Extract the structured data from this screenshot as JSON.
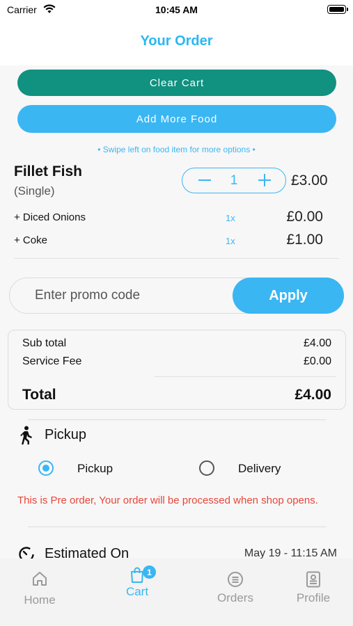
{
  "status_bar": {
    "carrier": "Carrier",
    "time": "10:45 AM"
  },
  "header": {
    "title": "Your Order"
  },
  "actions": {
    "clear_cart": "Clear Cart",
    "add_more_food": "Add More Food"
  },
  "hint": "• Swipe left on food item for more options •",
  "cart_item": {
    "name": "Fillet Fish",
    "variant": "(Single)",
    "quantity": "1",
    "price": "£3.00",
    "addons": [
      {
        "name": "+ Diced Onions",
        "qty": "1x",
        "price": "£0.00"
      },
      {
        "name": "+ Coke",
        "qty": "1x",
        "price": "£1.00"
      }
    ]
  },
  "promo": {
    "placeholder": "Enter promo code",
    "apply_label": "Apply"
  },
  "summary": {
    "subtotal_label": "Sub total",
    "subtotal_value": "£4.00",
    "fee_label": "Service Fee",
    "fee_value": "£0.00",
    "total_label": "Total",
    "total_value": "£4.00"
  },
  "fulfillment": {
    "title": "Pickup",
    "options": [
      {
        "label": "Pickup",
        "selected": true
      },
      {
        "label": "Delivery",
        "selected": false
      }
    ],
    "notice": "This is Pre order, Your order will be processed when shop opens."
  },
  "estimate": {
    "label": "Estimated On",
    "value": "May 19 - 11:15 AM"
  },
  "tabbar": {
    "home": "Home",
    "cart": "Cart",
    "cart_badge": "1",
    "orders": "Orders",
    "profile": "Profile"
  },
  "colors": {
    "accent": "#3ab6f3",
    "clear_cart": "#119180",
    "notice": "#e7463a"
  }
}
